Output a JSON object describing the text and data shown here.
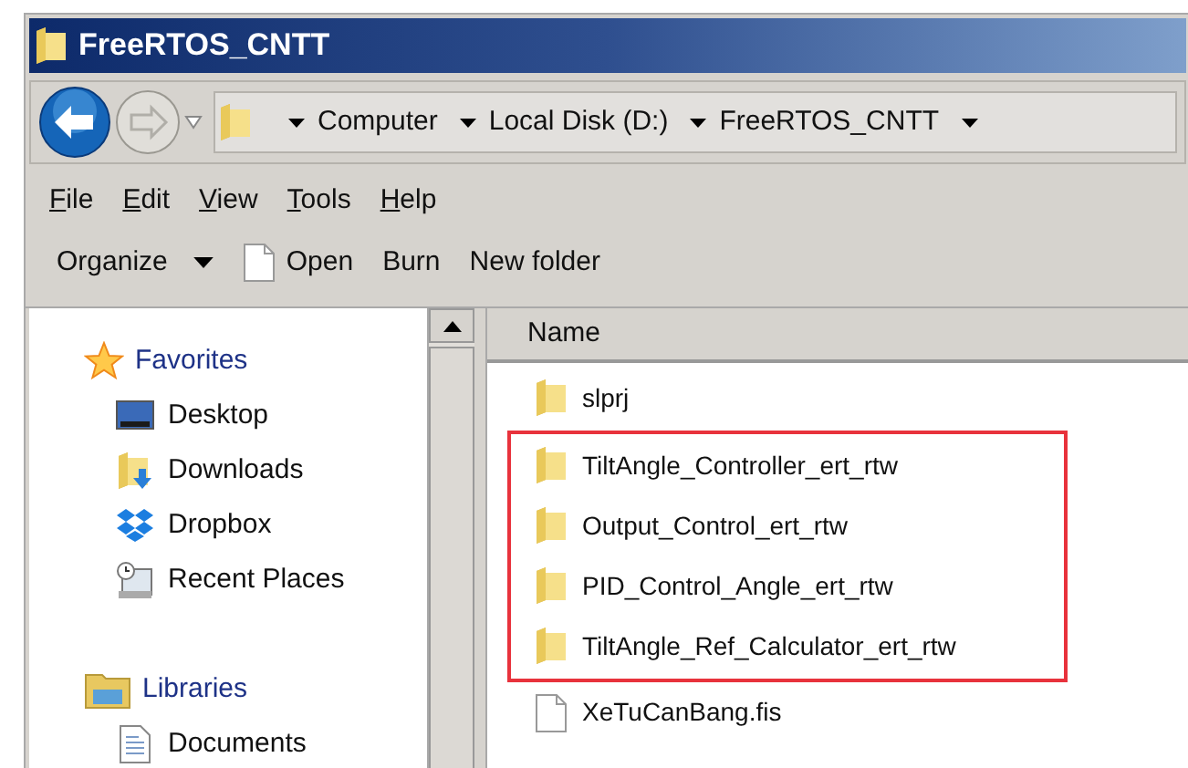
{
  "window": {
    "title": "FreeRTOS_CNTT"
  },
  "address_bar": {
    "crumbs": [
      "Computer",
      "Local Disk (D:)",
      "FreeRTOS_CNTT"
    ]
  },
  "menu": [
    {
      "label": "File"
    },
    {
      "label": "Edit"
    },
    {
      "label": "View"
    },
    {
      "label": "Tools"
    },
    {
      "label": "Help"
    }
  ],
  "toolbar": [
    {
      "label": "Organize",
      "kind": "dropdown"
    },
    {
      "label": "Open",
      "kind": "file"
    },
    {
      "label": "Burn",
      "kind": "plain"
    },
    {
      "label": "New folder",
      "kind": "plain"
    }
  ],
  "navigation": [
    {
      "label": "Favorites",
      "kind": "star",
      "children": [
        {
          "label": "Desktop",
          "kind": "desktop"
        },
        {
          "label": "Downloads",
          "kind": "downloads"
        },
        {
          "label": "Dropbox",
          "kind": "dropbox"
        },
        {
          "label": "Recent Places",
          "kind": "recent"
        }
      ]
    },
    {
      "label": "Libraries",
      "kind": "library",
      "children": [
        {
          "label": "Documents",
          "kind": "documents"
        }
      ]
    }
  ],
  "file_list": {
    "columns": [
      "Name"
    ],
    "items": [
      {
        "name": "slprj",
        "kind": "folder",
        "highlighted": false
      },
      {
        "name": "TiltAngle_Controller_ert_rtw",
        "kind": "folder",
        "highlighted": true
      },
      {
        "name": "Output_Control_ert_rtw",
        "kind": "folder",
        "highlighted": true
      },
      {
        "name": "PID_Control_Angle_ert_rtw",
        "kind": "folder",
        "highlighted": true
      },
      {
        "name": "TiltAngle_Ref_Calculator_ert_rtw",
        "kind": "folder",
        "highlighted": true
      },
      {
        "name": "XeTuCanBang.fis",
        "kind": "file",
        "highlighted": false
      }
    ]
  }
}
